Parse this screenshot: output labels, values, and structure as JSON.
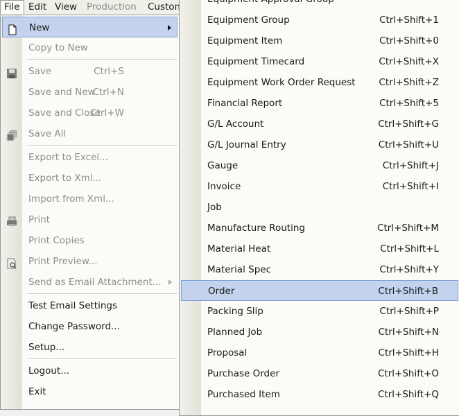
{
  "menubar": [
    {
      "label": "File",
      "state": "open"
    },
    {
      "label": "Edit"
    },
    {
      "label": "View"
    },
    {
      "label": "Production",
      "disabled": true
    },
    {
      "label": "Custom"
    }
  ],
  "file_menu": [
    {
      "label": "New",
      "icon": "new-document-icon",
      "submenu": true,
      "highlighted": true
    },
    {
      "label": "Copy to New",
      "disabled": true
    },
    {
      "separator": true
    },
    {
      "label": "Save",
      "shortcut": "Ctrl+S",
      "icon": "save-icon",
      "disabled": true
    },
    {
      "label": "Save and New",
      "shortcut": "Ctrl+N",
      "disabled": true
    },
    {
      "label": "Save and Close",
      "shortcut": "Ctrl+W",
      "disabled": true
    },
    {
      "label": "Save All",
      "icon": "save-all-icon",
      "disabled": true
    },
    {
      "separator": true
    },
    {
      "label": "Export to Excel...",
      "disabled": true
    },
    {
      "label": "Export to Xml...",
      "disabled": true
    },
    {
      "label": "Import from Xml...",
      "disabled": true
    },
    {
      "label": "Print",
      "icon": "printer-icon",
      "disabled": true
    },
    {
      "label": "Print Copies",
      "disabled": true
    },
    {
      "label": "Print Preview...",
      "icon": "print-preview-icon",
      "disabled": true
    },
    {
      "label": "Send as Email Attachment...",
      "submenu": true,
      "disabled": true
    },
    {
      "separator": true
    },
    {
      "label": "Test Email Settings"
    },
    {
      "label": "Change Password..."
    },
    {
      "label": "Setup..."
    },
    {
      "separator": true
    },
    {
      "label": "Logout..."
    },
    {
      "label": "Exit"
    }
  ],
  "new_submenu": [
    {
      "label": "Equipment Approval Group",
      "shortcut": ""
    },
    {
      "label": "Equipment Group",
      "shortcut": "Ctrl+Shift+1"
    },
    {
      "label": "Equipment Item",
      "shortcut": "Ctrl+Shift+0"
    },
    {
      "label": "Equipment Timecard",
      "shortcut": "Ctrl+Shift+X"
    },
    {
      "label": "Equipment Work Order Request",
      "shortcut": "Ctrl+Shift+Z"
    },
    {
      "label": "Financial Report",
      "shortcut": "Ctrl+Shift+5"
    },
    {
      "label": "G/L Account",
      "shortcut": "Ctrl+Shift+G"
    },
    {
      "label": "G/L Journal Entry",
      "shortcut": "Ctrl+Shift+U"
    },
    {
      "label": "Gauge",
      "shortcut": "Ctrl+Shift+J"
    },
    {
      "label": "Invoice",
      "shortcut": "Ctrl+Shift+I"
    },
    {
      "label": "Job",
      "shortcut": ""
    },
    {
      "label": "Manufacture Routing",
      "shortcut": "Ctrl+Shift+M"
    },
    {
      "label": "Material Heat",
      "shortcut": "Ctrl+Shift+L"
    },
    {
      "label": "Material Spec",
      "shortcut": "Ctrl+Shift+Y"
    },
    {
      "label": "Order",
      "shortcut": "Ctrl+Shift+B",
      "highlighted": true
    },
    {
      "label": "Packing Slip",
      "shortcut": "Ctrl+Shift+P"
    },
    {
      "label": "Planned Job",
      "shortcut": "Ctrl+Shift+N"
    },
    {
      "label": "Proposal",
      "shortcut": "Ctrl+Shift+H"
    },
    {
      "label": "Purchase Order",
      "shortcut": "Ctrl+Shift+O"
    },
    {
      "label": "Purchased Item",
      "shortcut": "Ctrl+Shift+Q"
    }
  ]
}
